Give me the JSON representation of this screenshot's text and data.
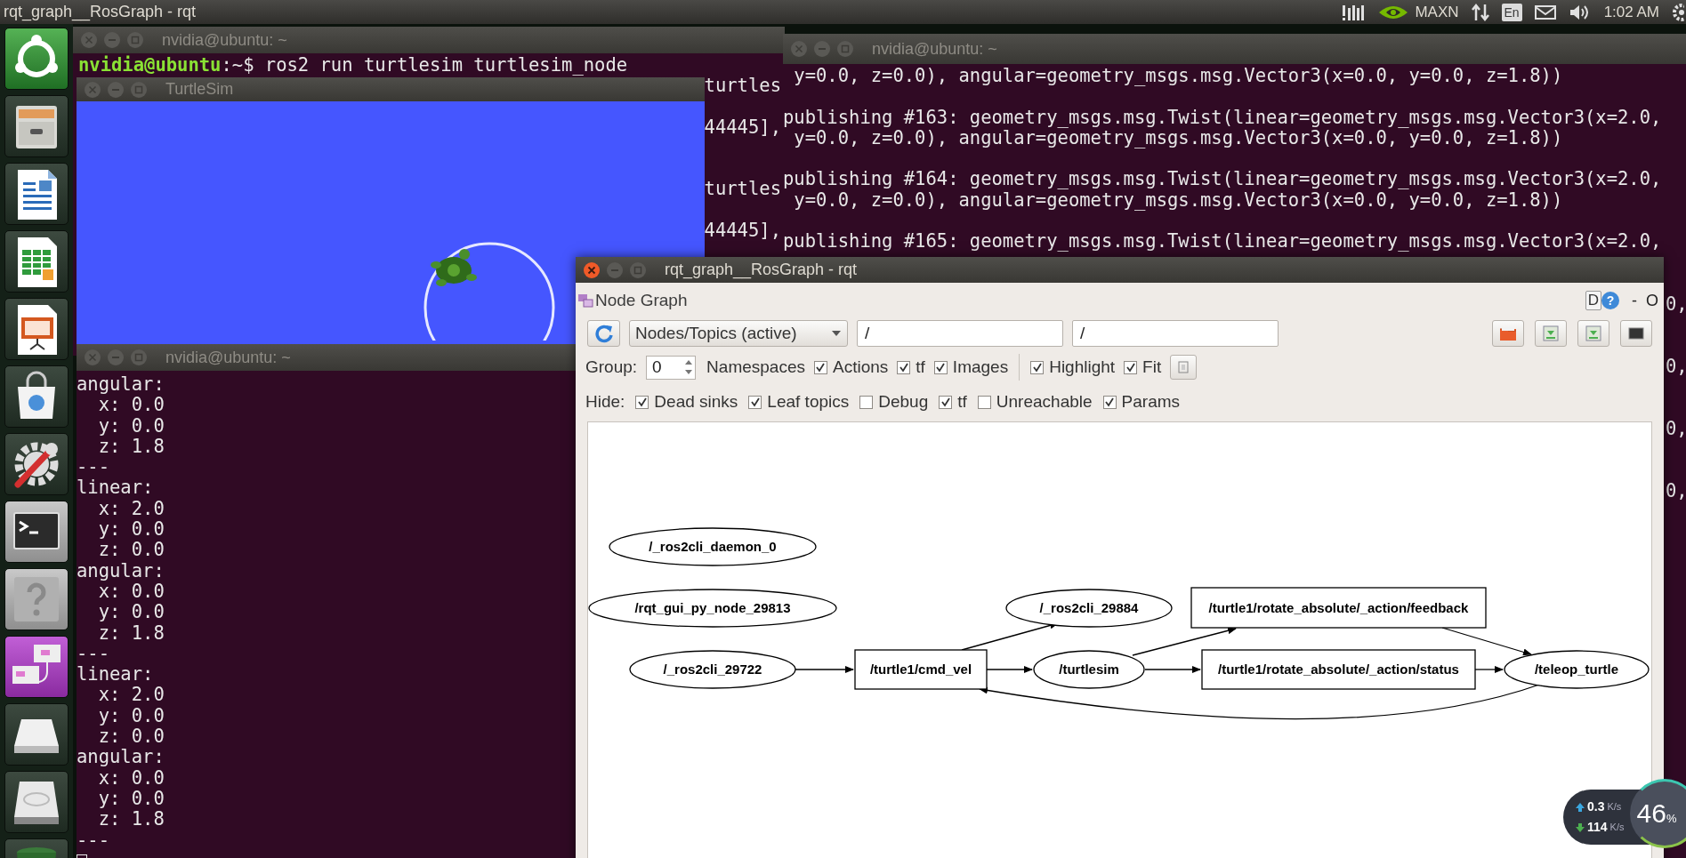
{
  "top_panel": {
    "title": "rqt_graph__RosGraph - rqt",
    "indicator": "MAXN",
    "keyboard": "En",
    "clock": "1:02 AM"
  },
  "terminal_top": {
    "title": "nvidia@ubuntu: ~",
    "prompt_user": "nvidia@ubuntu",
    "prompt_rest": ":~$ ros2 run turtlesim turtlesim_node",
    "fragment_groups": [
      [
        "turtles",
        "44445],"
      ],
      [
        "turtles",
        "44445],"
      ]
    ]
  },
  "terminal_right": {
    "title": "nvidia@ubuntu: ~",
    "groups": [
      [
        " y=0.0, z=0.0), angular=geometry_msgs.msg.Vector3(x=0.0, y=0.0, z=1.8))"
      ],
      [
        "publishing #163: geometry_msgs.msg.Twist(linear=geometry_msgs.msg.Vector3(x=2.0,",
        " y=0.0, z=0.0), angular=geometry_msgs.msg.Vector3(x=0.0, y=0.0, z=1.8))"
      ],
      [
        "publishing #164: geometry_msgs.msg.Twist(linear=geometry_msgs.msg.Vector3(x=2.0,",
        " y=0.0, z=0.0), angular=geometry_msgs.msg.Vector3(x=0.0, y=0.0, z=1.8))"
      ],
      [
        "publishing #165: geometry_msgs.msg.Twist(linear=geometry_msgs.msg.Vector3(x=2.0,"
      ]
    ],
    "edge_fragments": [
      "0,",
      "0,",
      "0,",
      "0,"
    ]
  },
  "turtlesim": {
    "title": "TurtleSim"
  },
  "terminal_bottom": {
    "title": "nvidia@ubuntu: ~",
    "lines": [
      "angular:",
      "  x: 0.0",
      "  y: 0.0",
      "  z: 1.8",
      "---",
      "linear:",
      "  x: 2.0",
      "  y: 0.0",
      "  z: 0.0",
      "angular:",
      "  x: 0.0",
      "  y: 0.0",
      "  z: 1.8",
      "---",
      "linear:",
      "  x: 2.0",
      "  y: 0.0",
      "  z: 0.0",
      "angular:",
      "  x: 0.0",
      "  y: 0.0",
      "  z: 1.8",
      "---"
    ]
  },
  "rqt": {
    "title": "rqt_graph__RosGraph - rqt",
    "plugin_title": "Node Graph",
    "plugin_buttons": [
      "D",
      "?",
      "-",
      "O"
    ],
    "mode": "Nodes/Topics (active)",
    "filters": [
      "/",
      "/"
    ],
    "group_label": "Group:",
    "group": "0",
    "namespaces_label": "Namespaces",
    "options": [
      {
        "label": "Actions",
        "checked": true
      },
      {
        "label": "tf",
        "checked": true
      },
      {
        "label": "Images",
        "checked": true
      }
    ],
    "view_options": [
      {
        "label": "Highlight",
        "checked": true
      },
      {
        "label": "Fit",
        "checked": true
      }
    ],
    "hide_label": "Hide:",
    "hide": [
      {
        "label": "Dead sinks",
        "checked": true
      },
      {
        "label": "Leaf topics",
        "checked": true
      },
      {
        "label": "Debug",
        "checked": false
      },
      {
        "label": "tf",
        "checked": true
      },
      {
        "label": "Unreachable",
        "checked": false
      },
      {
        "label": "Params",
        "checked": true
      }
    ],
    "graph": {
      "nodes": [
        {
          "kind": "node",
          "label": "/_ros2cli_daemon_0"
        },
        {
          "kind": "node",
          "label": "/rqt_gui_py_node_29813"
        },
        {
          "kind": "node",
          "label": "/_ros2cli_29722"
        },
        {
          "kind": "topic",
          "label": "/turtle1/cmd_vel"
        },
        {
          "kind": "node",
          "label": "/_ros2cli_29884"
        },
        {
          "kind": "node",
          "label": "/turtlesim"
        },
        {
          "kind": "topic",
          "label": "/turtle1/rotate_absolute/_action/feedback"
        },
        {
          "kind": "topic",
          "label": "/turtle1/rotate_absolute/_action/status"
        },
        {
          "kind": "node",
          "label": "/teleop_turtle"
        }
      ]
    }
  },
  "net_monitor": {
    "up": "0.3",
    "up_unit": "K/s",
    "down": "114",
    "down_unit": "K/s",
    "load": "46",
    "load_unit": "%"
  }
}
